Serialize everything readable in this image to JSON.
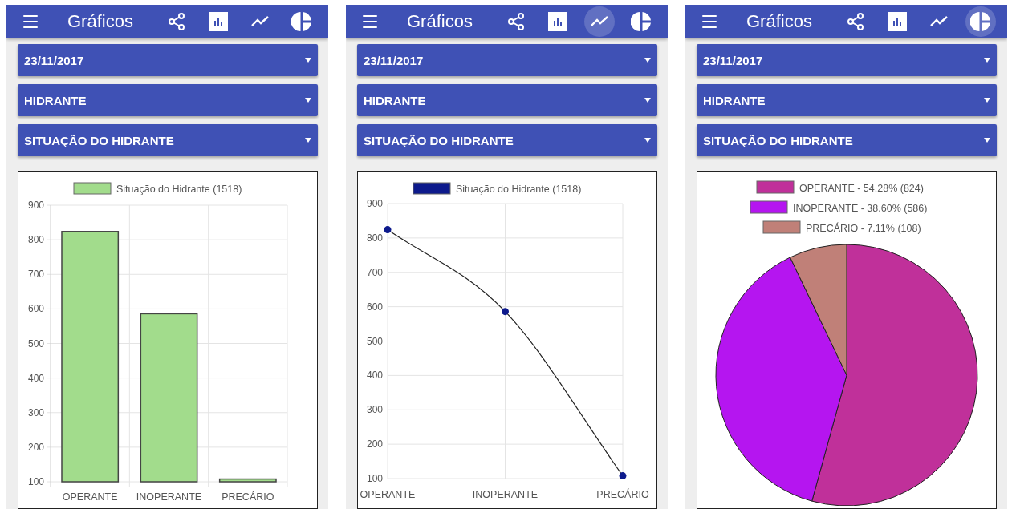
{
  "phones": [
    {
      "title": "Gráficos",
      "toolbar": [
        {
          "kind": "share",
          "selected": false
        },
        {
          "kind": "bar",
          "selected": false
        },
        {
          "kind": "line",
          "selected": false
        },
        {
          "kind": "pie",
          "selected": false
        }
      ],
      "filters": [
        "23/11/2017",
        "HIDRANTE",
        "SITUAÇÃO DO HIDRANTE"
      ],
      "chart_data": {
        "type": "bar",
        "categories": [
          "OPERANTE",
          "INOPERANTE",
          "PRECÁRIO"
        ],
        "series": [
          {
            "name": "Situação do Hidrante (1518)",
            "color": "#a2dc8c",
            "values": [
              824,
              586,
              108
            ]
          }
        ],
        "ylim": [
          100,
          900
        ],
        "yticks": [
          100,
          200,
          300,
          400,
          500,
          600,
          700,
          800,
          900
        ],
        "grid": true,
        "legend": "top"
      }
    },
    {
      "title": "Gráficos",
      "toolbar": [
        {
          "kind": "share",
          "selected": false
        },
        {
          "kind": "bar",
          "selected": false
        },
        {
          "kind": "line",
          "selected": true
        },
        {
          "kind": "pie",
          "selected": false
        }
      ],
      "filters": [
        "23/11/2017",
        "HIDRANTE",
        "SITUAÇÃO DO HIDRANTE"
      ],
      "chart_data": {
        "type": "line",
        "categories": [
          "OPERANTE",
          "INOPERANTE",
          "PRECÁRIO"
        ],
        "series": [
          {
            "name": "Situação do Hidrante (1518)",
            "color": "#0d1a8c",
            "marker": "circle",
            "values": [
              824,
              586,
              108
            ]
          }
        ],
        "ylim": [
          100,
          900
        ],
        "yticks": [
          100,
          200,
          300,
          400,
          500,
          600,
          700,
          800,
          900
        ],
        "grid": true,
        "legend": "top"
      }
    },
    {
      "title": "Gráficos",
      "toolbar": [
        {
          "kind": "share",
          "selected": false
        },
        {
          "kind": "bar",
          "selected": false
        },
        {
          "kind": "line",
          "selected": false
        },
        {
          "kind": "pie",
          "selected": true
        }
      ],
      "filters": [
        "23/11/2017",
        "HIDRANTE",
        "SITUAÇÃO DO HIDRANTE"
      ],
      "chart_data": {
        "type": "pie",
        "categories": [
          "OPERANTE - 54.28% (824)",
          "INOPERANTE - 38.60% (586)",
          "PRECÁRIO - 7.11% (108)"
        ],
        "legend": "top",
        "series": [
          {
            "colors": [
              "#c0309a",
              "#b515f0",
              "#c08078"
            ],
            "values": [
              824,
              586,
              108
            ]
          }
        ]
      }
    }
  ]
}
